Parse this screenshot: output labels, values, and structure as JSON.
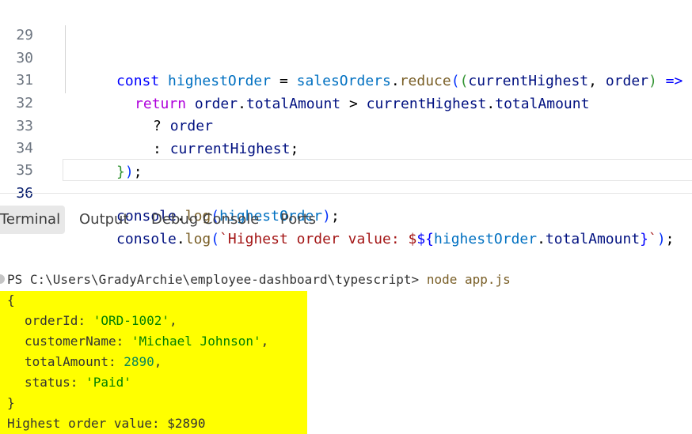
{
  "editor": {
    "active_line": "36",
    "lines": [
      {
        "num": "29",
        "t": [
          "const",
          " highestOrder",
          " = ",
          "salesOrders",
          ".",
          "reduce",
          "(",
          "(",
          "currentHighest",
          ", ",
          "order",
          ")",
          " => ",
          "{"
        ]
      },
      {
        "num": "30",
        "t": [
          "return",
          " order",
          ".",
          "totalAmount",
          " > ",
          "currentHighest",
          ".",
          "totalAmount"
        ]
      },
      {
        "num": "31",
        "t": [
          "? ",
          "order"
        ]
      },
      {
        "num": "32",
        "t": [
          ": ",
          "currentHighest",
          ";"
        ]
      },
      {
        "num": "33",
        "t": [
          "}",
          ")",
          ";"
        ]
      },
      {
        "num": "34",
        "t": []
      },
      {
        "num": "35",
        "t": [
          "console",
          ".",
          "log",
          "(",
          "highestOrder",
          ")",
          ";"
        ]
      },
      {
        "num": "36",
        "t": [
          "console",
          ".",
          "log",
          "(",
          "`Highest order value: $",
          "${",
          "highestOrder",
          ".",
          "totalAmount",
          "}",
          "`",
          ")",
          ";"
        ]
      }
    ]
  },
  "panel": {
    "tabs": [
      "Terminal",
      "Output",
      "Debug Console",
      "Ports"
    ],
    "active_tab": "Terminal"
  },
  "terminal": {
    "prompt": "PS C:\\Users\\GradyArchie\\employee-dashboard\\typescript> ",
    "command": "node app.js",
    "output": {
      "open_brace": "{",
      "fields": [
        {
          "key": "orderId",
          "value": "'ORD-1002'",
          "kind": "str",
          "sep": ","
        },
        {
          "key": "customerName",
          "value": "'Michael Johnson'",
          "kind": "str",
          "sep": ","
        },
        {
          "key": "totalAmount",
          "value": "2890",
          "kind": "num",
          "sep": ","
        },
        {
          "key": "status",
          "value": "'Paid'",
          "kind": "str",
          "sep": ""
        }
      ],
      "close_brace": "}",
      "result_line": "Highest order value: $2890"
    },
    "highlight_color": "#ffff00"
  }
}
